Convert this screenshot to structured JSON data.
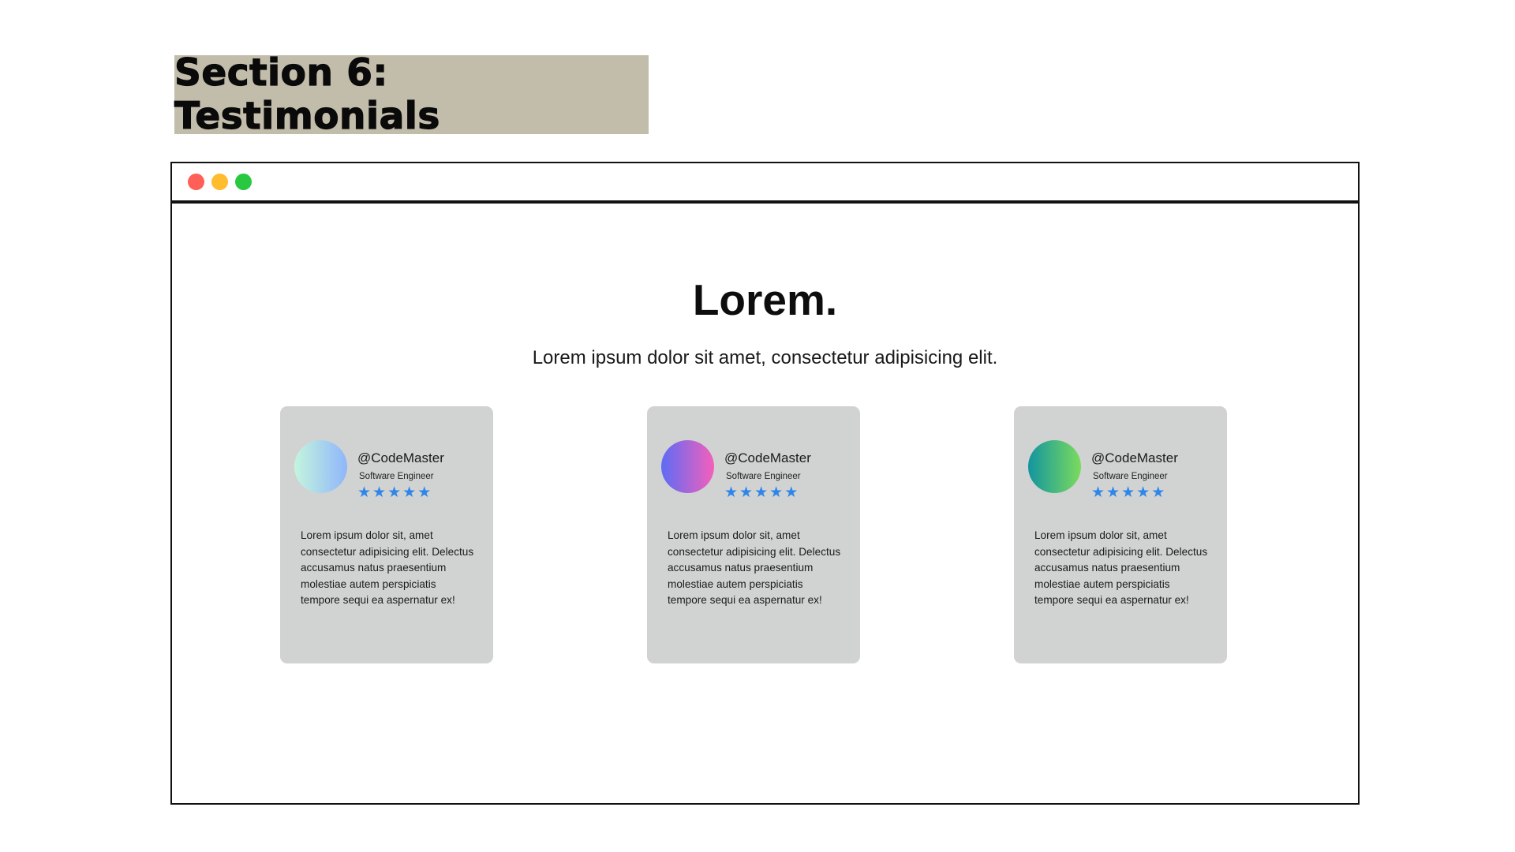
{
  "section": {
    "label": "Section 6: Testimonials"
  },
  "window": {
    "controls": [
      "close-dot",
      "minimize-dot",
      "maximize-dot"
    ],
    "control_colors": [
      "#fe5f57",
      "#febc2e",
      "#28c840"
    ]
  },
  "hero": {
    "title": "Lorem.",
    "subtitle": "Lorem ipsum dolor sit amet, consectetur adipisicing elit."
  },
  "testimonials": [
    {
      "handle": "@CodeMaster",
      "role": "Software Engineer",
      "rating": 5,
      "stars": "★★★★★",
      "quote": "Lorem ipsum dolor sit, amet consectetur adipisicing elit. Delectus accusamus natus praesentium molestiae autem perspiciatis tempore sequi ea aspernatur ex!",
      "avatar_colors": [
        "#c4f5dd",
        "#8fb6fb"
      ]
    },
    {
      "handle": "@CodeMaster",
      "role": "Software Engineer",
      "rating": 5,
      "stars": "★★★★★",
      "quote": "Lorem ipsum dolor sit, amet consectetur adipisicing elit. Delectus accusamus natus praesentium molestiae autem perspiciatis tempore sequi ea aspernatur ex!",
      "avatar_colors": [
        "#5d6cf5",
        "#f45fbb"
      ]
    },
    {
      "handle": "@CodeMaster",
      "role": "Software Engineer",
      "rating": 5,
      "stars": "★★★★★",
      "quote": "Lorem ipsum dolor sit, amet consectetur adipisicing elit. Delectus accusamus natus praesentium molestiae autem perspiciatis tempore sequi ea aspernatur ex!",
      "avatar_colors": [
        "#12959f",
        "#7bdb5d"
      ]
    }
  ],
  "colors": {
    "section_label_bg": "#c2bcab",
    "card_bg": "#d1d3d2",
    "star": "#2f86e8"
  }
}
